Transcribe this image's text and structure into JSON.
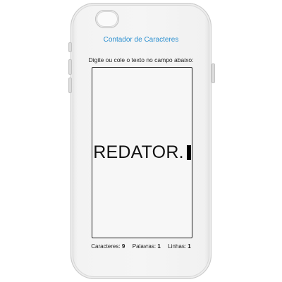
{
  "app": {
    "title": "Contador de Caracteres",
    "instruction": "Digite ou cole o texto no campo abaixo:"
  },
  "editor": {
    "text": "REDATOR."
  },
  "stats": {
    "characters_label": "Caracteres:",
    "characters_value": "9",
    "words_label": "Palavras:",
    "words_value": "1",
    "lines_label": "Linhas:",
    "lines_value": "1"
  },
  "colors": {
    "title": "#2a8fd0",
    "case": "#f3f3f3",
    "text": "#111111"
  }
}
